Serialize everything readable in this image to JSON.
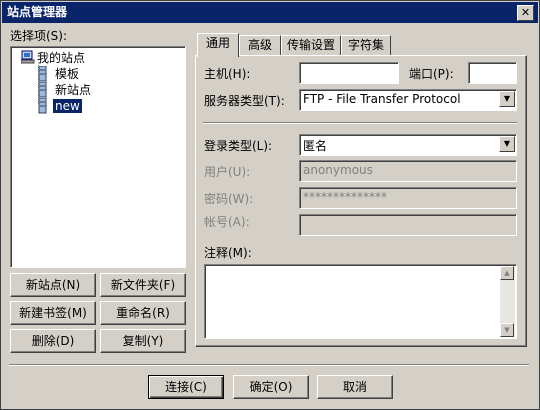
{
  "window": {
    "title": "站点管理器",
    "close_glyph": "✕"
  },
  "left": {
    "select_label": "选择项(S):",
    "tree": [
      {
        "label": "我的站点",
        "icon": "computer-icon"
      },
      {
        "label": "模板",
        "icon": "server-icon"
      },
      {
        "label": "新站点",
        "icon": "server-icon"
      },
      {
        "label": "new",
        "icon": "server-icon",
        "selected": true
      }
    ],
    "buttons": {
      "new_site": "新站点(N)",
      "new_folder": "新文件夹(F)",
      "new_bookmark": "新建书签(M)",
      "rename": "重命名(R)",
      "delete": "删除(D)",
      "copy": "复制(Y)"
    }
  },
  "tabs": [
    "通用",
    "高级",
    "传输设置",
    "字符集"
  ],
  "general": {
    "host_label": "主机(H):",
    "host_value": "",
    "port_label": "端口(P):",
    "port_value": "",
    "server_type_label": "服务器类型(T):",
    "server_type_value": "FTP - File Transfer Protocol",
    "login_type_label": "登录类型(L):",
    "login_type_value": "匿名",
    "user_label": "用户(U):",
    "user_value": "anonymous",
    "password_label": "密码(W):",
    "password_value": "**************",
    "account_label": "帐号(A):",
    "account_value": "",
    "comment_label": "注释(M):",
    "comment_value": ""
  },
  "footer": {
    "connect": "连接(C)",
    "ok": "确定(O)",
    "cancel": "取消"
  }
}
